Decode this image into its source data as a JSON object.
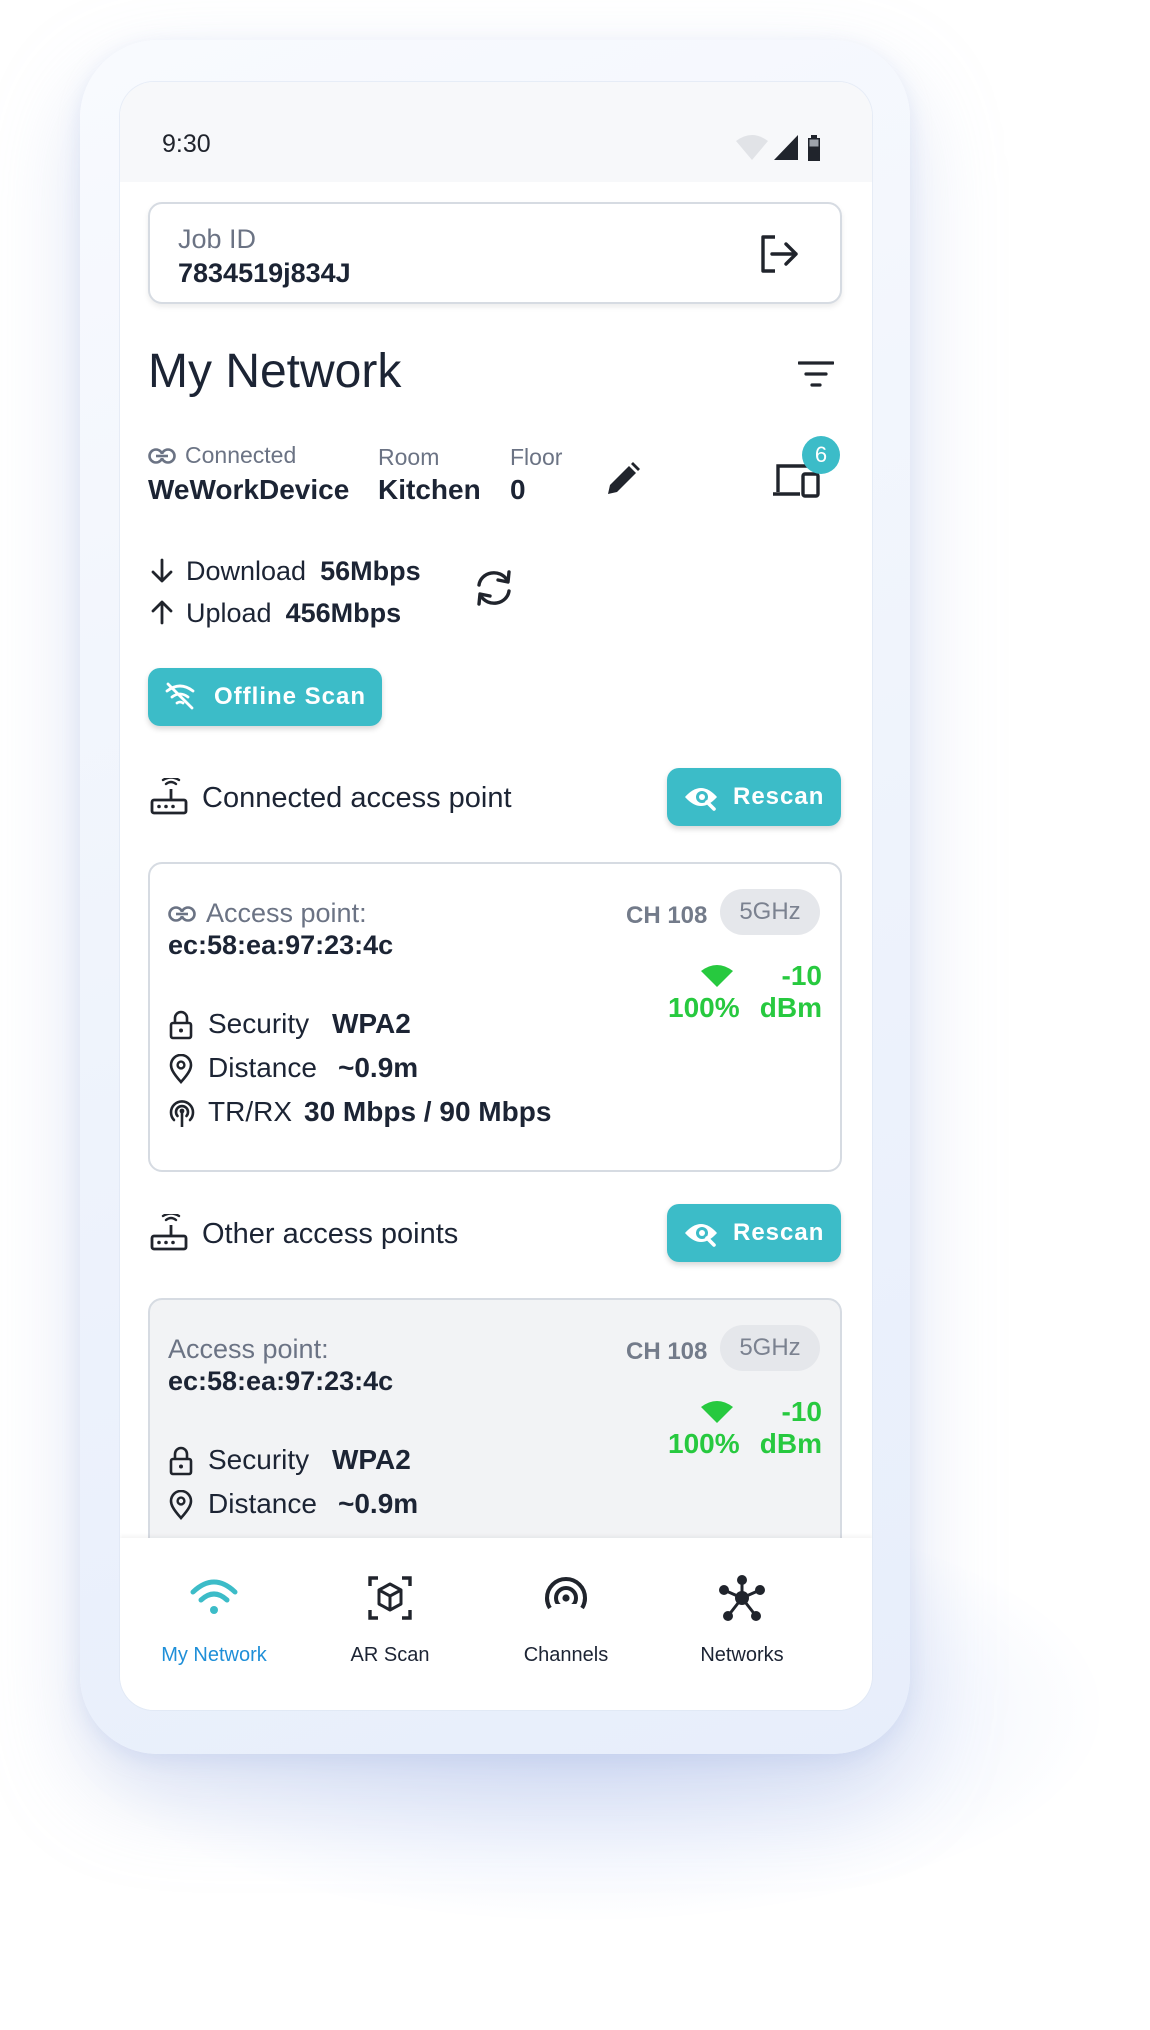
{
  "status": {
    "time": "9:30"
  },
  "job": {
    "label": "Job ID",
    "value": "7834519j834J"
  },
  "title": "My Network",
  "connection": {
    "connected_label": "Connected",
    "connected_value": "WeWorkDevice",
    "room_label": "Room",
    "room_value": "Kitchen",
    "floor_label": "Floor",
    "floor_value": "0",
    "devices_count": "6"
  },
  "speed": {
    "download_label": "Download",
    "download_value": "56Mbps",
    "upload_label": "Upload",
    "upload_value": "456Mbps"
  },
  "offline_scan_label": "Offline Scan",
  "connected_section": {
    "title": "Connected access point",
    "rescan_label": "Rescan",
    "card": {
      "ap_label": "Access point:",
      "mac": "ec:58:ea:97:23:4c",
      "channel": "CH 108",
      "band": "5GHz",
      "signal_pct": "100%",
      "signal_dbm_value": "-10",
      "signal_dbm_unit": "dBm",
      "security_label": "Security",
      "security_value": "WPA2",
      "distance_label": "Distance",
      "distance_value": "~0.9m",
      "trrx_label": "TR/RX",
      "trrx_value": "30 Mbps / 90 Mbps"
    }
  },
  "other_section": {
    "title": "Other access points",
    "rescan_label": "Rescan",
    "card": {
      "ap_label": "Access point:",
      "mac": "ec:58:ea:97:23:4c",
      "channel": "CH 108",
      "band": "5GHz",
      "signal_pct": "100%",
      "signal_dbm_value": "-10",
      "signal_dbm_unit": "dBm",
      "security_label": "Security",
      "security_value": "WPA2",
      "distance_label": "Distance",
      "distance_value": "~0.9m"
    }
  },
  "nav": [
    {
      "label": "My Network",
      "icon": "wifi-icon",
      "active": true
    },
    {
      "label": "AR Scan",
      "icon": "ar-cube-icon",
      "active": false
    },
    {
      "label": "Channels",
      "icon": "broadcast-icon",
      "active": false
    },
    {
      "label": "Networks",
      "icon": "network-hub-icon",
      "active": false
    }
  ],
  "colors": {
    "accent": "#3cbcc8",
    "signal": "#27c93f",
    "active_nav": "#1f8fd8",
    "text": "#1c2434"
  }
}
